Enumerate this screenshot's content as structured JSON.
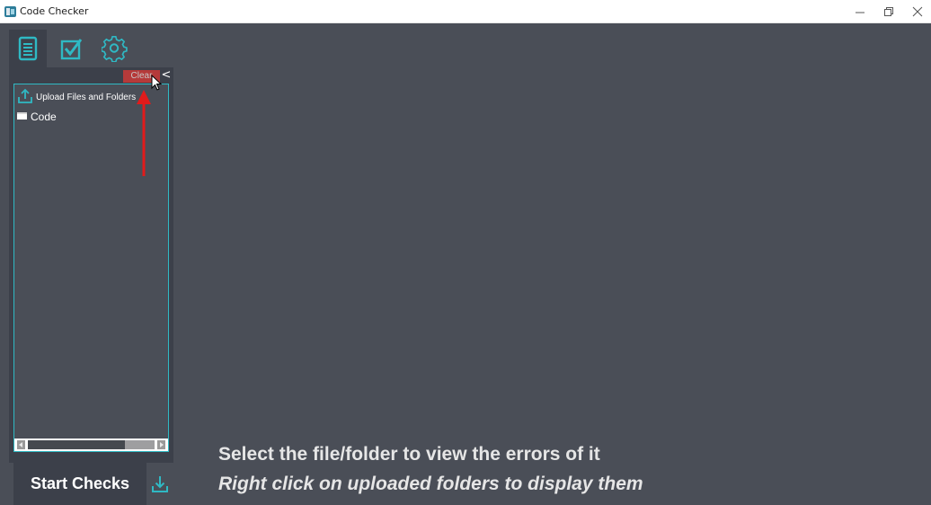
{
  "window": {
    "title": "Code Checker",
    "icon": "code-checker-logo-icon",
    "controls": [
      "minimize-icon",
      "maximize-icon",
      "close-icon"
    ]
  },
  "tabs": [
    {
      "icon": "document-icon",
      "active": true
    },
    {
      "icon": "checkbox-icon",
      "active": false
    },
    {
      "icon": "gear-icon",
      "active": false
    }
  ],
  "sidebar": {
    "clear_label": "Clear",
    "collapse_label": "<",
    "upload_label": "Upload Files and Folders",
    "tree": [
      {
        "label": "Code",
        "icon": "folder-icon"
      }
    ],
    "start_label": "Start Checks",
    "download_icon": "download-icon"
  },
  "main": {
    "hint_line1": "Select the file/folder to view the errors of it",
    "hint_line2": "Right click on uploaded folders to display them"
  },
  "colors": {
    "background": "#4a4e57",
    "panel": "#3c404a",
    "accent": "#2fb9c4",
    "clear_button": "#b53a3a",
    "annotation_arrow": "#e21b1b"
  }
}
